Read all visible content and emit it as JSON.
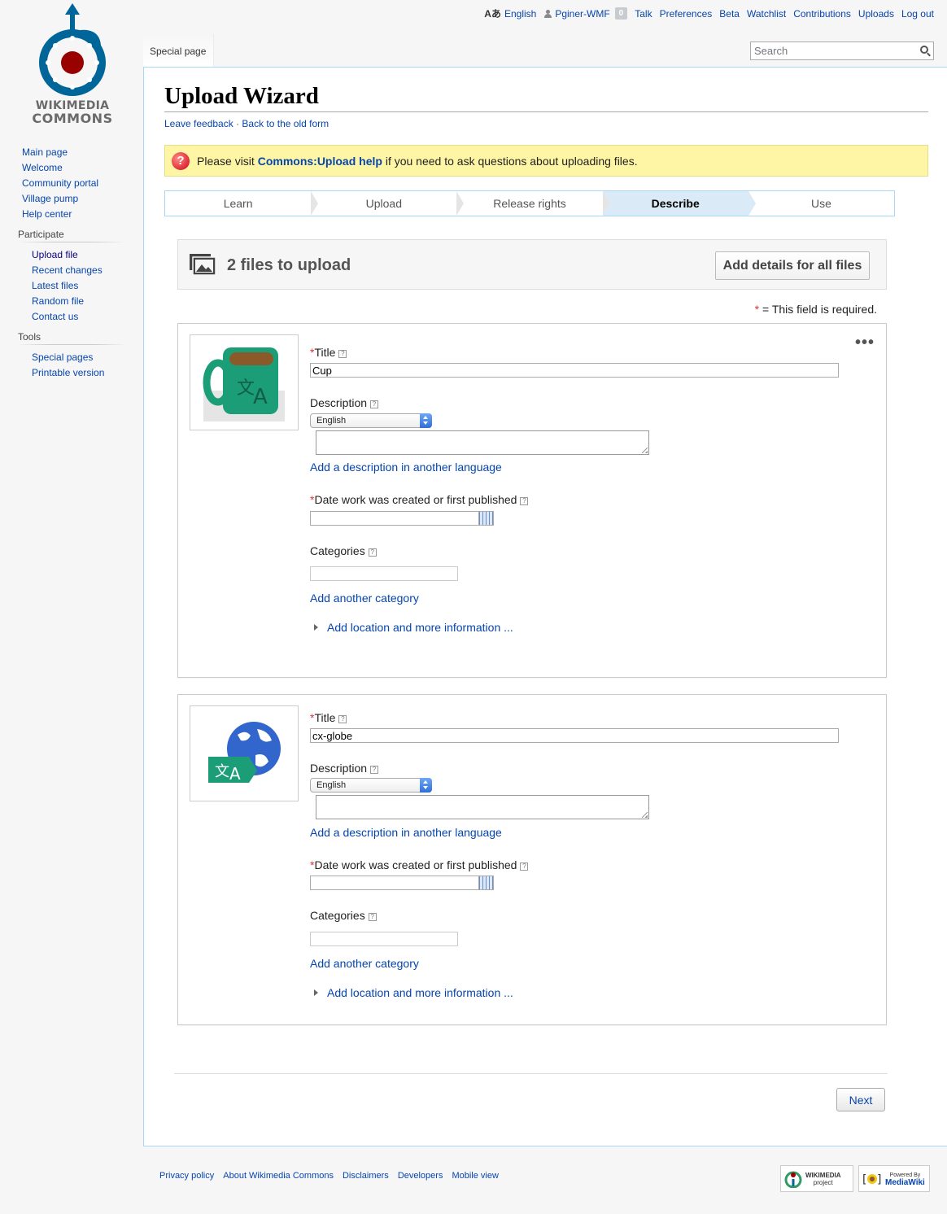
{
  "site": {
    "logo_line1": "WIKIMEDIA",
    "logo_line2": "COMMONS"
  },
  "personal_tools": {
    "language_icon": "Aあ",
    "language": "English",
    "username": "Pginer-WMF",
    "notification_count": "0",
    "items": [
      "Talk",
      "Preferences",
      "Beta",
      "Watchlist",
      "Contributions",
      "Uploads",
      "Log out"
    ]
  },
  "tabs": {
    "special_page": "Special page"
  },
  "search": {
    "placeholder": "Search"
  },
  "sidebar": {
    "main": [
      "Main page",
      "Welcome",
      "Community portal",
      "Village pump",
      "Help center"
    ],
    "participate_heading": "Participate",
    "participate": [
      "Upload file",
      "Recent changes",
      "Latest files",
      "Random file",
      "Contact us"
    ],
    "tools_heading": "Tools",
    "tools": [
      "Special pages",
      "Printable version"
    ]
  },
  "page": {
    "title": "Upload Wizard",
    "leave_feedback": "Leave feedback",
    "separator": "·",
    "old_form": "Back to the old form"
  },
  "notice": {
    "before": "Please visit ",
    "link": "Commons:Upload help",
    "after": " if you need to ask questions about uploading files."
  },
  "steps": [
    "Learn",
    "Upload",
    "Release rights",
    "Describe",
    "Use"
  ],
  "active_step": "Describe",
  "files_header": {
    "count_label": "2 files to upload",
    "add_all_button": "Add details for all files"
  },
  "required_note": {
    "star": "*",
    "text": " = This field is required."
  },
  "form_labels": {
    "required_star": "*",
    "title": "Title",
    "description": "Description",
    "add_description": "Add a description in another language",
    "date": "Date work was created or first published",
    "categories": "Categories",
    "add_category": "Add another category",
    "more_info": "Add location and more information ...",
    "more_menu": "•••",
    "help_mark": "?"
  },
  "files": [
    {
      "title_value": "Cup",
      "language": "English",
      "thumbnail": "cup-translate-icon"
    },
    {
      "title_value": "cx-globe",
      "language": "English",
      "thumbnail": "globe-translate-icon"
    }
  ],
  "next_button": "Next",
  "footer": {
    "links": [
      "Privacy policy",
      "About Wikimedia Commons",
      "Disclaimers",
      "Developers",
      "Mobile view"
    ],
    "badge1_line1": "WIKIMEDIA",
    "badge1_line2": "project",
    "badge2_line1": "Powered By",
    "badge2_line2": "MediaWiki"
  },
  "colors": {
    "link": "#0645ad",
    "notice_bg": "#fef6a4",
    "active_step_bg": "#dbeaf7",
    "required": "#dd3333",
    "cup_green": "#1b9e77",
    "globe_blue": "#3366cc"
  }
}
